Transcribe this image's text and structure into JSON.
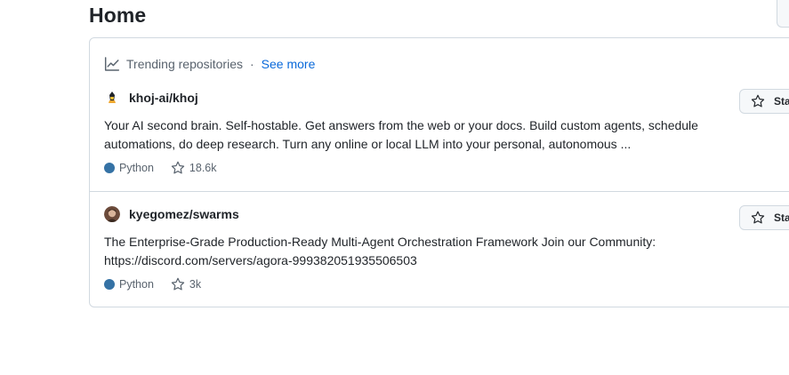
{
  "page": {
    "title": "Home"
  },
  "trending": {
    "header_label": "Trending repositories",
    "separator": "·",
    "see_more_label": "See more",
    "repos": [
      {
        "name": "khoj-ai/khoj",
        "description": "Your AI second brain. Self-hostable. Get answers from the web or your docs. Build custom agents, schedule automations, do deep research. Turn any online or local LLM into your personal, autonomous ...",
        "language": "Python",
        "language_color": "#3572A5",
        "stars": "18.6k",
        "star_button_label": "Star"
      },
      {
        "name": "kyegomez/swarms",
        "description": "The Enterprise-Grade Production-Ready Multi-Agent Orchestration Framework Join our Community: https://discord.com/servers/agora-999382051935506503",
        "language": "Python",
        "language_color": "#3572A5",
        "stars": "3k",
        "star_button_label": "Star"
      }
    ]
  },
  "colors": {
    "link": "#0969da",
    "border": "#d1d9e0",
    "muted_text": "#59636e"
  }
}
